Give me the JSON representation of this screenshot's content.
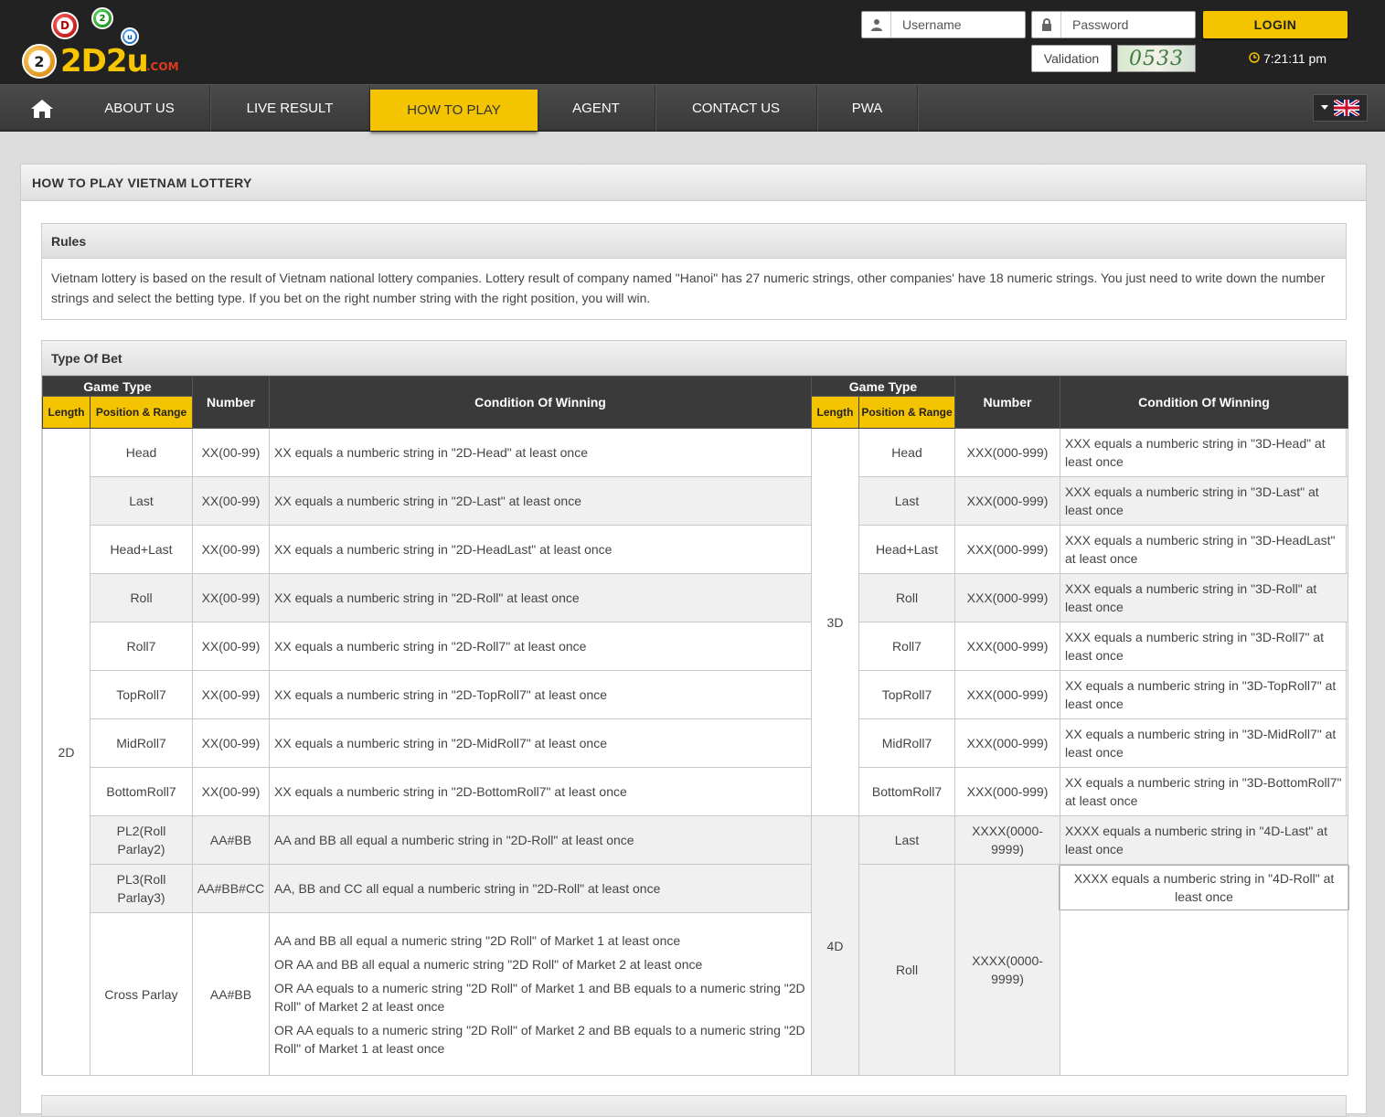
{
  "brand": {
    "logo_text": "2D2u",
    "logo_com": ".COM",
    "balls": [
      "D",
      "2",
      "u",
      "2"
    ]
  },
  "header": {
    "username_placeholder": "Username",
    "password_placeholder": "Password",
    "login_label": "LOGIN",
    "validation_placeholder": "Validation",
    "captcha_code": "0533",
    "clock": "7:21:11 pm"
  },
  "nav": {
    "items": [
      {
        "label": "ABOUT US"
      },
      {
        "label": "LIVE RESULT"
      },
      {
        "label": "HOW TO PLAY",
        "active": true
      },
      {
        "label": "AGENT"
      },
      {
        "label": "CONTACT US"
      },
      {
        "label": "PWA"
      }
    ]
  },
  "page": {
    "title": "HOW TO PLAY VIETNAM LOTTERY",
    "rules_title": "Rules",
    "rules_text": "Vietnam lottery is based on the result of Vietnam national lottery companies. Lottery result of company named \"Hanoi\" has 27 numeric strings, other companies' have 18 numeric strings. You just need to write down the number strings and select the betting type. If you bet on the right number string with the right position, you will win.",
    "type_title": "Type Of Bet"
  },
  "table": {
    "headers": {
      "game_type": "Game Type",
      "length": "Length",
      "position": "Position & Range",
      "number": "Number",
      "condition": "Condition Of Winning"
    },
    "left_length_2d": "2D",
    "right_length_3d": "3D",
    "right_length_4d": "4D",
    "rows": [
      {
        "pos": "Head",
        "num": "XX(00-99)",
        "cond": "XX equals a numberic string in \"2D-Head\" at least once",
        "rpos": "Head",
        "rnum": "XXX(000-999)",
        "rcond": "XXX equals a numberic string in \"3D-Head\" at least once"
      },
      {
        "pos": "Last",
        "num": "XX(00-99)",
        "cond": "XX equals a numberic string in \"2D-Last\" at least once",
        "rpos": "Last",
        "rnum": "XXX(000-999)",
        "rcond": "XXX equals a numberic string in \"3D-Last\" at least once"
      },
      {
        "pos": "Head+Last",
        "num": "XX(00-99)",
        "cond": "XX equals a numberic string in \"2D-HeadLast\" at least once",
        "rpos": "Head+Last",
        "rnum": "XXX(000-999)",
        "rcond": "XXX equals a numberic string in \"3D-HeadLast\" at least once"
      },
      {
        "pos": "Roll",
        "num": "XX(00-99)",
        "cond": "XX equals a numberic string in \"2D-Roll\" at least once",
        "rpos": "Roll",
        "rnum": "XXX(000-999)",
        "rcond": "XXX equals a numberic string in \"3D-Roll\" at least once"
      },
      {
        "pos": "Roll7",
        "num": "XX(00-99)",
        "cond": "XX equals a numberic string in \"2D-Roll7\" at least once",
        "rpos": "Roll7",
        "rnum": "XXX(000-999)",
        "rcond": "XXX equals a numberic string in \"3D-Roll7\" at least once"
      },
      {
        "pos": "TopRoll7",
        "num": "XX(00-99)",
        "cond": "XX equals a numberic string in \"2D-TopRoll7\" at least once",
        "rpos": "TopRoll7",
        "rnum": "XXX(000-999)",
        "rcond": "XX equals a numberic string in \"3D-TopRoll7\" at least once"
      },
      {
        "pos": "MidRoll7",
        "num": "XX(00-99)",
        "cond": "XX equals a numberic string in \"2D-MidRoll7\" at least once",
        "rpos": "MidRoll7",
        "rnum": "XXX(000-999)",
        "rcond": "XX equals a numberic string in \"3D-MidRoll7\" at least once"
      },
      {
        "pos": "BottomRoll7",
        "num": "XX(00-99)",
        "cond": "XX equals a numberic string in \"2D-BottomRoll7\" at least once",
        "rpos": "BottomRoll7",
        "rnum": "XXX(000-999)",
        "rcond": "XX equals a numberic string in \"3D-BottomRoll7\" at least once"
      },
      {
        "pos": "PL2(Roll Parlay2)",
        "num": "AA#BB",
        "cond": "AA and BB all equal a numberic string in \"2D-Roll\" at least once",
        "rpos": "Last",
        "rnum": "XXXX(0000-9999)",
        "rcond": "XXXX equals a numberic string in \"4D-Last\" at least once"
      },
      {
        "pos": "PL3(Roll Parlay3)",
        "num": "AA#BB#CC",
        "cond": "AA, BB and CC all equal a numberic string in \"2D-Roll\" at least once",
        "rpos": "Roll",
        "rnum": "XXXX(0000-9999)",
        "rcond": "XXXX equals a numberic string in \"4D-Roll\" at least once"
      }
    ],
    "cross": {
      "pos": "Cross Parlay",
      "num": "AA#BB",
      "conds": [
        "AA and BB all equal a numeric string \"2D Roll\" of Market 1 at least once",
        "OR AA and BB all equal a numeric string \"2D Roll\" of Market 2 at least once",
        "OR AA equals to a numeric string \"2D Roll\" of Market 1 and BB equals to a numeric string \"2D Roll\" of Market 2 at least once",
        "OR AA equals to a numeric string \"2D Roll\" of Market 2 and BB equals to a numeric string \"2D Roll\" of Market 1 at least once"
      ]
    }
  }
}
